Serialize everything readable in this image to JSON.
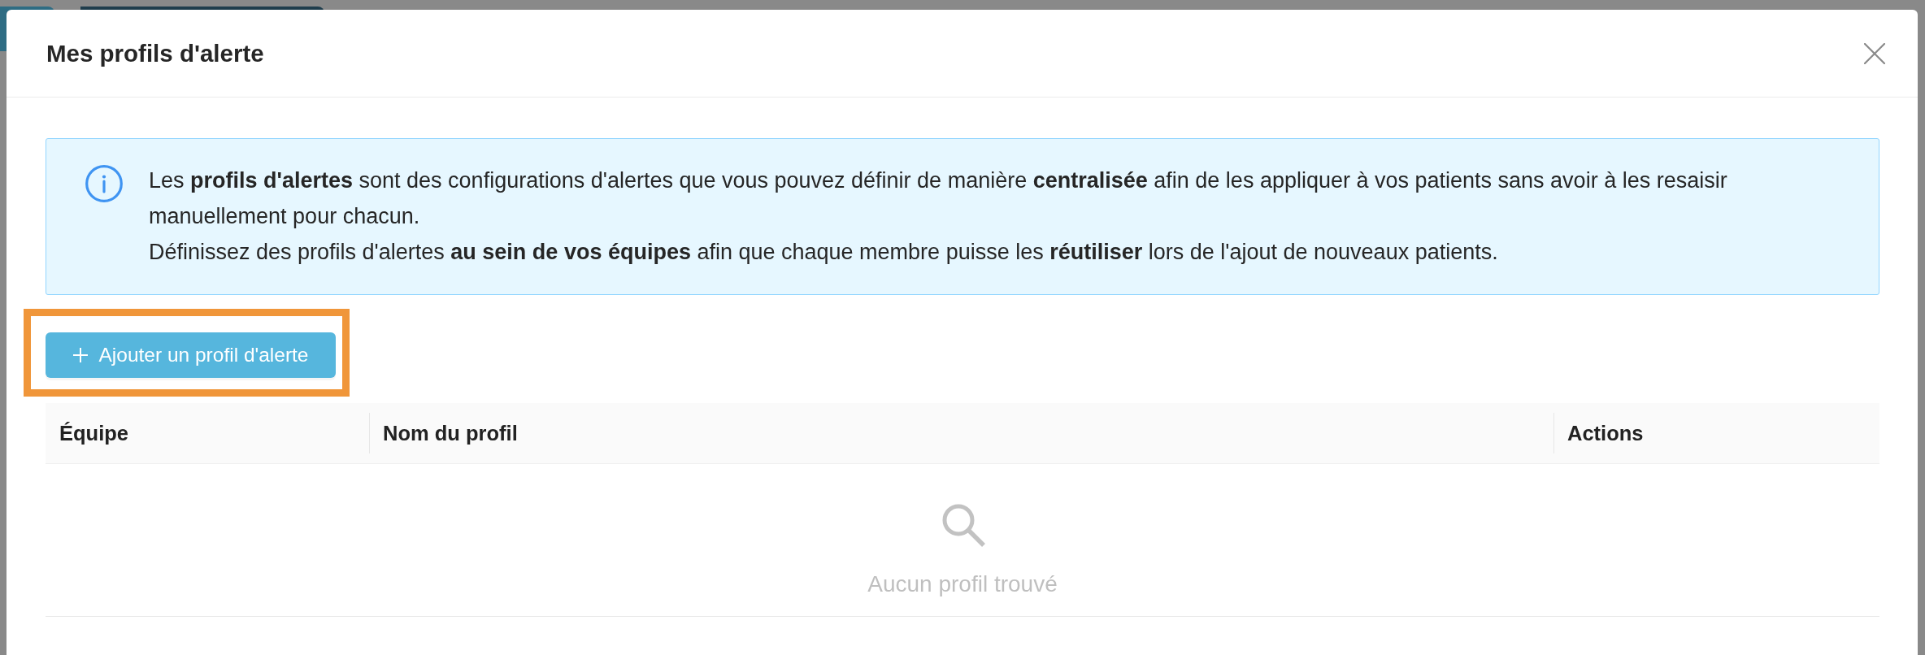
{
  "dialog": {
    "title": "Mes profils d'alerte"
  },
  "info_notice": {
    "paragraphs": [
      "Les **profils d'alertes** sont des configurations d'alertes que vous pouvez définir de manière **centralisée** afin de les appliquer à vos patients sans avoir à les resaisir manuellement pour chacun.",
      "Définissez des profils d'alertes **au sein de vos équipes** afin que chaque membre puisse les **réutiliser** lors de l'ajout de nouveaux patients."
    ]
  },
  "add_button": {
    "label": "Ajouter un profil d'alerte",
    "highlighted": true
  },
  "table": {
    "columns": [
      "Équipe",
      "Nom du profil",
      "Actions"
    ],
    "empty_state": {
      "message": "Aucun profil trouvé"
    }
  }
}
